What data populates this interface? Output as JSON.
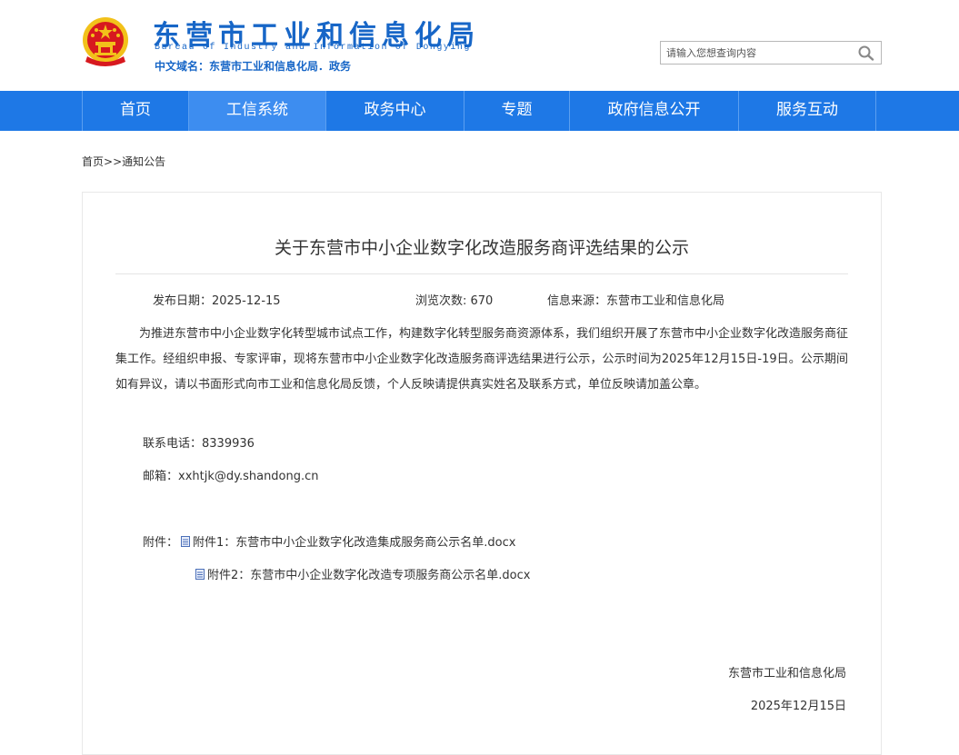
{
  "header": {
    "title": "东营市工业和信息化局",
    "title_en_words": [
      "Bureau",
      "of",
      "Industry",
      "and",
      "Information",
      "of",
      "Dongying"
    ],
    "domain_text": "中文域名：东营市工业和信息化局．政务",
    "emblem_icon": "national-emblem-icon"
  },
  "search": {
    "placeholder": "请输入您想查询内容",
    "button_icon": "search-icon"
  },
  "nav": {
    "items": [
      {
        "label": "首页"
      },
      {
        "label": "工信系统"
      },
      {
        "label": "政务中心"
      },
      {
        "label": "专题"
      },
      {
        "label": "政府信息公开"
      },
      {
        "label": "服务互动"
      }
    ]
  },
  "breadcrumb": {
    "home": "首页",
    "separator": ">>",
    "current": "通知公告"
  },
  "article": {
    "title": "关于东营市中小企业数字化改造服务商评选结果的公示",
    "publish_date": "发布日期：2025-12-15",
    "views": "浏览次数: 670",
    "source": "信息来源：东营市工业和信息化局",
    "body": "为推进东营市中小企业数字化转型城市试点工作，构建数字化转型服务商资源体系，我们组织开展了东营市中小企业数字化改造服务商征集工作。经组织申报、专家评审，现将东营市中小企业数字化改造服务商评选结果进行公示，公示时间为2025年12月15日-19日。公示期间如有异议，请以书面形式向市工业和信息化局反馈，个人反映请提供真实姓名及联系方式，单位反映请加盖公章。",
    "phone": "联系电话：8339936",
    "email": "邮箱：xxhtjk@dy.shandong.cn",
    "attachments_label": "附件：",
    "attachments": [
      {
        "label": "附件1：东营市中小企业数字化改造集成服务商公示名单.docx",
        "icon": "docx-file-icon"
      },
      {
        "label": "附件2：东营市中小企业数字化改造专项服务商公示名单.docx",
        "icon": "docx-file-icon"
      }
    ],
    "signature": "东营市工业和信息化局",
    "sign_date": "2025年12月15日"
  },
  "colors": {
    "brand_blue": "#1766c7",
    "nav_blue": "#1e78e6",
    "emblem_red": "#d7191f",
    "emblem_gold": "#f2c11a"
  }
}
